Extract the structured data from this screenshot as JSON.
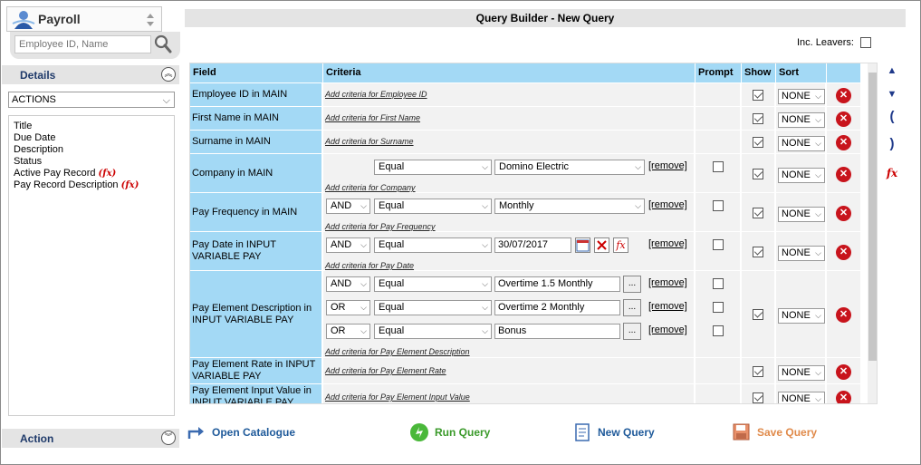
{
  "app": {
    "name": "Payroll"
  },
  "search": {
    "placeholder": "Employee ID, Name"
  },
  "details": {
    "title": "Details"
  },
  "actions_select": {
    "value": "ACTIONS"
  },
  "fields": [
    {
      "label": "Title",
      "fx": ""
    },
    {
      "label": "Due Date",
      "fx": ""
    },
    {
      "label": "Description",
      "fx": ""
    },
    {
      "label": "Status",
      "fx": ""
    },
    {
      "label": "Active Pay Record",
      "fx": "(fx)"
    },
    {
      "label": "Pay Record Description",
      "fx": "(fx)"
    }
  ],
  "action_section": {
    "title": "Action"
  },
  "page": {
    "title": "Query Builder - New Query",
    "inc_leavers_label": "Inc. Leavers:"
  },
  "grid": {
    "headers": {
      "field": "Field",
      "criteria": "Criteria",
      "prompt": "Prompt",
      "show": "Show",
      "sort": "Sort"
    },
    "remove_label": "[remove]",
    "rows": [
      {
        "field": "Employee ID in MAIN",
        "add": "Add criteria for Employee ID",
        "sort": "NONE",
        "show": true
      },
      {
        "field": "First Name in MAIN",
        "add": "Add criteria for First Name",
        "sort": "NONE",
        "show": true
      },
      {
        "field": "Surname in MAIN",
        "add": "Add criteria for Surname",
        "sort": "NONE",
        "show": true
      },
      {
        "field": "Company in MAIN",
        "add": "Add criteria for Company",
        "sort": "NONE",
        "show": true,
        "criteria": [
          {
            "conj": "",
            "op": "Equal",
            "value": "Domino Electric"
          }
        ]
      },
      {
        "field": "Pay Frequency in MAIN",
        "add": "Add criteria for Pay Frequency",
        "sort": "NONE",
        "show": true,
        "criteria": [
          {
            "conj": "AND",
            "op": "Equal",
            "value": "Monthly"
          }
        ]
      },
      {
        "field": "Pay Date in INPUT VARIABLE PAY",
        "add": "Add criteria for Pay Date",
        "sort": "NONE",
        "show": true,
        "criteria": [
          {
            "conj": "AND",
            "op": "Equal",
            "value": "30/07/2017"
          }
        ]
      },
      {
        "field": "Pay Element Description in INPUT VARIABLE PAY",
        "add": "Add criteria for Pay Element Description",
        "sort": "NONE",
        "show": true,
        "criteria": [
          {
            "conj": "AND",
            "op": "Equal",
            "value": "Overtime 1.5 Monthly"
          },
          {
            "conj": "OR",
            "op": "Equal",
            "value": "Overtime 2 Monthly"
          },
          {
            "conj": "OR",
            "op": "Equal",
            "value": "Bonus"
          }
        ]
      },
      {
        "field": "Pay Element Rate in INPUT VARIABLE PAY",
        "add": "Add criteria for Pay Element Rate",
        "sort": "NONE",
        "show": true
      },
      {
        "field": "Pay Element Input Value in INPUT VARIABLE PAY",
        "add": "Add criteria for Pay Element Input Value",
        "sort": "NONE",
        "show": true
      }
    ]
  },
  "side_controls": {
    "open_paren": "(",
    "close_paren": ")",
    "fx": "fx"
  },
  "bottom": {
    "open_catalogue": "Open Catalogue",
    "run_query": "Run Query",
    "new_query": "New Query",
    "save_query": "Save Query"
  },
  "colors": {
    "header_blue": "#a3d9f5",
    "link_blue": "#1f5a9a",
    "run_green": "#3a9a2a",
    "save_orange": "#e08a4a",
    "delete_red": "#c8141c"
  }
}
